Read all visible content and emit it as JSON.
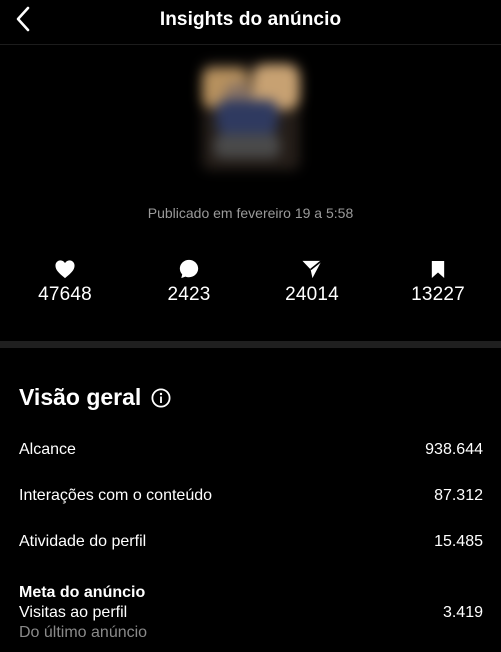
{
  "header": {
    "title": "Insights do anúncio",
    "back_icon": "chevron-left-icon"
  },
  "post": {
    "published": "Publicado em fevereiro 19 a 5:58"
  },
  "stats": [
    {
      "icon": "heart-icon",
      "value": "47648"
    },
    {
      "icon": "comment-icon",
      "value": "2423"
    },
    {
      "icon": "send-icon",
      "value": "24014"
    },
    {
      "icon": "bookmark-icon",
      "value": "13227"
    }
  ],
  "overview": {
    "title": "Visão geral",
    "info_icon": "info-icon",
    "rows": [
      {
        "label": "Alcance",
        "value": "938.644"
      },
      {
        "label": "Interações com o conteúdo",
        "value": "87.312"
      },
      {
        "label": "Atividade do perfil",
        "value": "15.485"
      }
    ],
    "goal": {
      "title": "Meta do anúncio",
      "label": "Visitas ao perfil",
      "value": "3.419",
      "sub": "Do último anúncio"
    }
  },
  "colors": {
    "background": "#000000",
    "text": "#ffffff",
    "muted": "#9a9a9a",
    "divider": "#1f1f1f"
  }
}
